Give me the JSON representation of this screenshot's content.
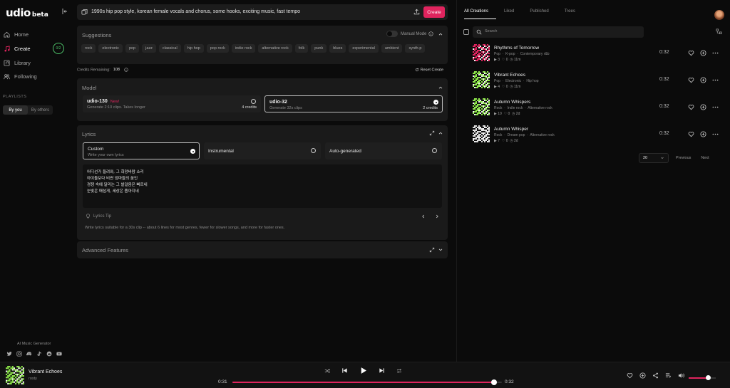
{
  "brand": {
    "name": "udio",
    "tag": "beta"
  },
  "nav": [
    {
      "label": "Home",
      "icon": "home-icon"
    },
    {
      "label": "Create",
      "icon": "music-note-icon"
    },
    {
      "label": "Library",
      "icon": "library-icon"
    },
    {
      "label": "Following",
      "icon": "users-icon"
    }
  ],
  "sidebar": {
    "credits_badge": "0/2",
    "playlists_label": "PLAYLISTS",
    "toggle": [
      "By you",
      "By others"
    ],
    "footer_label": "AI Music Generator",
    "socials": [
      "twitter-icon",
      "instagram-icon",
      "discord-icon",
      "tiktok-icon",
      "reddit-icon",
      "youtube-icon"
    ]
  },
  "prompt": {
    "text": "1990s hip pop style, korean female vocals and chorus, some hooks, exciting music, fast tempo",
    "create_label": "Create"
  },
  "suggestions": {
    "title": "Suggestions",
    "manual_mode": "Manual Mode",
    "chips": [
      "rock",
      "electronic",
      "pop",
      "jazz",
      "classical",
      "hip hop",
      "pop rock",
      "indie rock",
      "alternative rock",
      "folk",
      "punk",
      "blues",
      "experimental",
      "ambient",
      "synth-p"
    ]
  },
  "credits": {
    "label": "Credits Remaining:",
    "value": "108",
    "reset_label": "Reset Create"
  },
  "model": {
    "title": "Model",
    "options": [
      {
        "name": "udio-130",
        "badge": "New!",
        "desc": "Generate 2:10 clips. Takes longer",
        "credits": "4 credits",
        "selected": false
      },
      {
        "name": "udio-32",
        "badge": "",
        "desc": "Generate 32s clips",
        "credits": "2 credits",
        "selected": true
      }
    ]
  },
  "lyrics": {
    "title": "Lyrics",
    "options": [
      {
        "label": "Custom",
        "desc": "Write your own lyrics",
        "selected": true
      },
      {
        "label": "Instrumental",
        "desc": "",
        "selected": false
      },
      {
        "label": "Auto-generated",
        "desc": "",
        "selected": false
      }
    ],
    "lines": [
      "어디선가 들려와, 그 희망바람 소리",
      "아이돌보다 비싼 엄마들의 꿈인",
      "경쟁 속에 달리는 그 발걸음은 빠르네",
      "눈빛은 매섭게, 세상은 좁아지네"
    ],
    "tip_label": "Lyrics Tip",
    "tip_text": "Write lyrics suitable for a 30s clip -- about 6 lines for most genres, fewer for slower songs, and more for faster ones."
  },
  "advanced": {
    "title": "Advanced Features"
  },
  "right": {
    "tabs": [
      "All Creations",
      "Liked",
      "Published",
      "Trees"
    ],
    "search_placeholder": "Search",
    "songs": [
      {
        "title": "Rhythms of Tomorrow",
        "tags": [
          "Pop",
          "K-pop",
          "Contemporary r&b"
        ],
        "plays": "3",
        "likes": "0",
        "age": "11m",
        "duration": "0:32",
        "accent": "#e0245e"
      },
      {
        "title": "Vibrant Echoes",
        "tags": [
          "Pop",
          "Electronic",
          "Hip hop"
        ],
        "plays": "4",
        "likes": "0",
        "age": "11m",
        "duration": "0:32",
        "accent": "#8ee84a"
      },
      {
        "title": "Autumn Whispers",
        "tags": [
          "Rock",
          "Indie rock",
          "Alternative rock"
        ],
        "plays": "10",
        "likes": "0",
        "age": "2d",
        "duration": "0:32",
        "accent": "#8ee84a"
      },
      {
        "title": "Autumn Whisper",
        "tags": [
          "Rock",
          "Dream pop",
          "Alternative rock"
        ],
        "plays": "7",
        "likes": "0",
        "age": "2d",
        "duration": "0:32",
        "accent": "#dddddd"
      }
    ],
    "pager": {
      "per_page": "20",
      "prev": "Previous",
      "next": "Next"
    }
  },
  "player": {
    "title": "Vibrant Echoes",
    "artist": "rosty",
    "current": "0:31",
    "total": "0:32",
    "progress": 0.97,
    "volume": 0.7
  }
}
